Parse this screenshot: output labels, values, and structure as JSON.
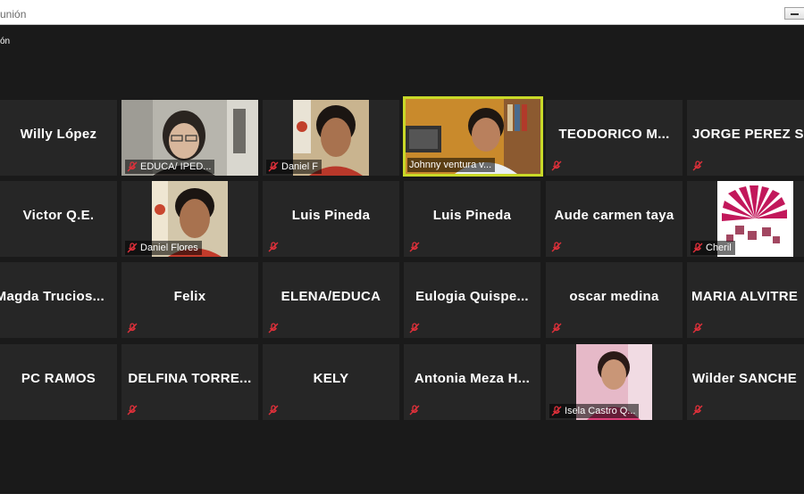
{
  "window": {
    "title": "unión"
  },
  "meeting": {
    "label": "ón"
  },
  "participants": [
    {
      "name": "Willy López"
    },
    {
      "name": "EDUCA/ IPED...",
      "video": true
    },
    {
      "name": "Daniel F",
      "video": true
    },
    {
      "name": "Johnny ventura v...",
      "video": true,
      "active": true
    },
    {
      "name": "TEODORICO M..."
    },
    {
      "name": "JORGE PEREZ S"
    },
    {
      "name": "Victor Q.E."
    },
    {
      "name": "Daniel Flores",
      "video": true
    },
    {
      "name": "Luis Pineda"
    },
    {
      "name": "Luis Pineda"
    },
    {
      "name": "Aude carmen taya"
    },
    {
      "name": "Cheril",
      "video": true
    },
    {
      "name": "Magda Trucios..."
    },
    {
      "name": "Felix"
    },
    {
      "name": "ELENA/EDUCA"
    },
    {
      "name": "Eulogia Quispe..."
    },
    {
      "name": "oscar medina"
    },
    {
      "name": "MARIA ALVITRE"
    },
    {
      "name": "PC RAMOS"
    },
    {
      "name": "DELFINA TORRE..."
    },
    {
      "name": "KELY"
    },
    {
      "name": "Antonia Meza H..."
    },
    {
      "name": "Isela Castro Q...",
      "video": true
    },
    {
      "name": "Wilder SANCHE"
    }
  ],
  "colors": {
    "active_speaker": "#c9d928",
    "muted_icon": "#e0303a",
    "tile_bg": "#262626",
    "app_bg": "#1a1a1a"
  },
  "icons": {
    "muted": "microphone-muted-icon"
  }
}
